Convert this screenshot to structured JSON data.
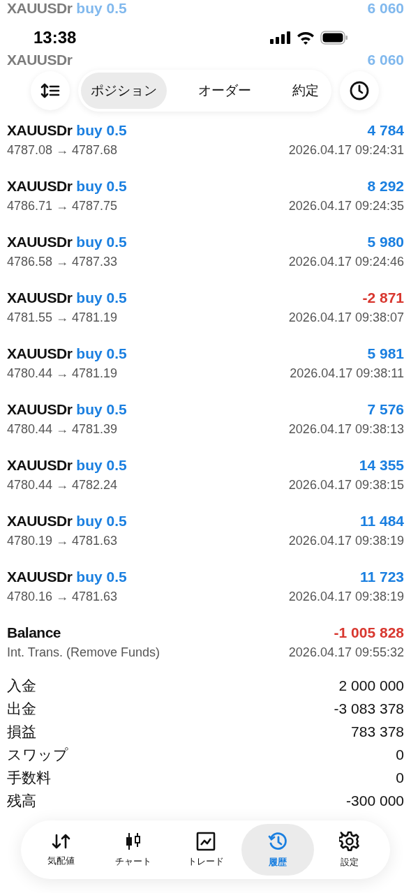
{
  "faded_rows": [
    {
      "symbol": "XAUUSDr",
      "side": "buy 0.5",
      "value": "6 060"
    },
    {
      "symbol": "XAUUSDr",
      "value": "6 060"
    }
  ],
  "status_bar": {
    "time": "13:38"
  },
  "tabs": [
    {
      "label": "ポジション",
      "selected": true
    },
    {
      "label": "オーダー",
      "selected": false
    },
    {
      "label": "約定",
      "selected": false
    }
  ],
  "deals": [
    {
      "symbol": "XAUUSDr",
      "side": "buy 0.5",
      "prices": "4787.08 → 4787.68",
      "time": "2026.04.17 09:24:31",
      "value": "4 784",
      "color": "#1a7fe0"
    },
    {
      "symbol": "XAUUSDr",
      "side": "buy 0.5",
      "prices": "4786.71 → 4787.75",
      "time": "2026.04.17 09:24:35",
      "value": "8 292",
      "color": "#1a7fe0"
    },
    {
      "symbol": "XAUUSDr",
      "side": "buy 0.5",
      "prices": "4786.58 → 4787.33",
      "time": "2026.04.17 09:24:46",
      "value": "5 980",
      "color": "#1a7fe0"
    },
    {
      "symbol": "XAUUSDr",
      "side": "buy 0.5",
      "prices": "4781.55 → 4781.19",
      "time": "2026.04.17 09:38:07",
      "value": "-2 871",
      "color": "#d8372f"
    },
    {
      "symbol": "XAUUSDr",
      "side": "buy 0.5",
      "prices": "4780.44 → 4781.19",
      "time": "2026.04.17 09:38:11",
      "value": "5 981",
      "color": "#1a7fe0"
    },
    {
      "symbol": "XAUUSDr",
      "side": "buy 0.5",
      "prices": "4780.44 → 4781.39",
      "time": "2026.04.17 09:38:13",
      "value": "7 576",
      "color": "#1a7fe0"
    },
    {
      "symbol": "XAUUSDr",
      "side": "buy 0.5",
      "prices": "4780.44 → 4782.24",
      "time": "2026.04.17 09:38:15",
      "value": "14 355",
      "color": "#1a7fe0"
    },
    {
      "symbol": "XAUUSDr",
      "side": "buy 0.5",
      "prices": "4780.19 → 4781.63",
      "time": "2026.04.17 09:38:19",
      "value": "11 484",
      "color": "#1a7fe0"
    },
    {
      "symbol": "XAUUSDr",
      "side": "buy 0.5",
      "prices": "4780.16 → 4781.63",
      "time": "2026.04.17 09:38:19",
      "value": "11 723",
      "color": "#1a7fe0"
    },
    {
      "symbol": "Balance",
      "prices": "Int. Trans. (Remove Funds)",
      "time": "2026.04.17 09:55:32",
      "value": "-1 005 828",
      "color": "#d8372f"
    }
  ],
  "summary": [
    {
      "label": "入金",
      "value": "2 000 000"
    },
    {
      "label": "出金",
      "value": "-3 083 378"
    },
    {
      "label": "損益",
      "value": "783 378"
    },
    {
      "label": "スワップ",
      "value": "0"
    },
    {
      "label": "手数料",
      "value": "0"
    },
    {
      "label": "残高",
      "value": "-300 000"
    }
  ],
  "bottom_nav": [
    {
      "kind": "quotes",
      "label": "気配値",
      "selected": false
    },
    {
      "kind": "chart",
      "label": "チャート",
      "selected": false
    },
    {
      "kind": "trade",
      "label": "トレード",
      "selected": false
    },
    {
      "kind": "history",
      "label": "履歴",
      "selected": true
    },
    {
      "kind": "settings",
      "label": "設定",
      "selected": false
    }
  ]
}
